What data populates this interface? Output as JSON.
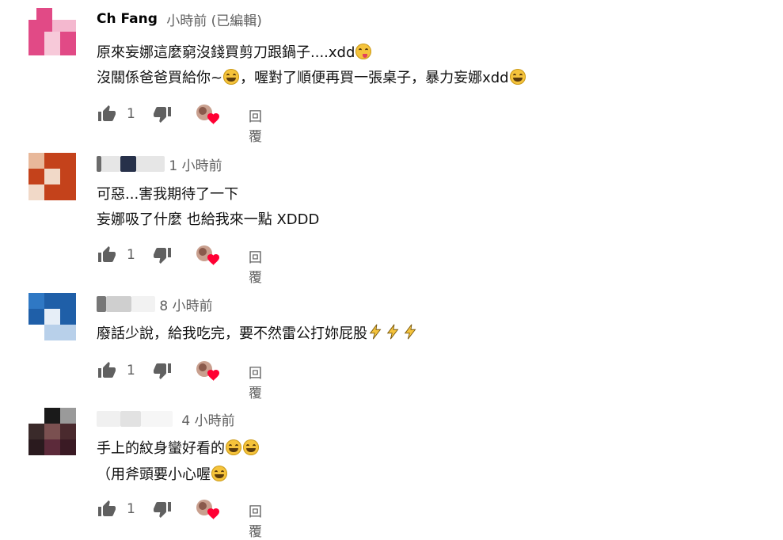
{
  "comments": [
    {
      "author": "Ch Fang",
      "time": "小時前 (已編輯)",
      "lines": [
        {
          "text": "原來妄娜這麼窮沒錢買剪刀跟鍋子....xdd",
          "emoji": "wink-tongue-emoji"
        },
        {
          "text1": "沒關係爸爸買給你~",
          "emoji1": "laughing-emoji",
          "text2": "，喔對了順便再買一張桌子，暴力妄娜xdd",
          "emoji2": "sweat-smile-emoji"
        }
      ],
      "likes": "1",
      "reply_label": "回覆"
    },
    {
      "author": "",
      "time": "1 小時前",
      "lines": [
        {
          "text": "可惡...害我期待了一下"
        },
        {
          "text": "妄娜吸了什麼 也給我來一點 XDDD"
        }
      ],
      "likes": "1",
      "reply_label": "回覆"
    },
    {
      "author": "",
      "time": "8 小時前",
      "lines": [
        {
          "text": "廢話少說，給我吃完，要不然雷公打妳屁股",
          "emoji": "lightning-emoji"
        }
      ],
      "likes": "1",
      "reply_label": "回覆"
    },
    {
      "author": "",
      "time": "4 小時前",
      "lines": [
        {
          "text": "手上的紋身蠻好看的",
          "emoji": "laughing-emoji"
        },
        {
          "text": "（用斧頭要小心喔",
          "emoji": "laughing-emoji"
        }
      ],
      "likes": "1",
      "reply_label": "回覆"
    }
  ],
  "colors": {
    "meta_text": "#606060",
    "body_text": "#111111",
    "heart": "#ff0033"
  },
  "icons": [
    "thumb-up-icon",
    "thumb-down-icon",
    "creator-heart-icon",
    "lightning-icon"
  ]
}
